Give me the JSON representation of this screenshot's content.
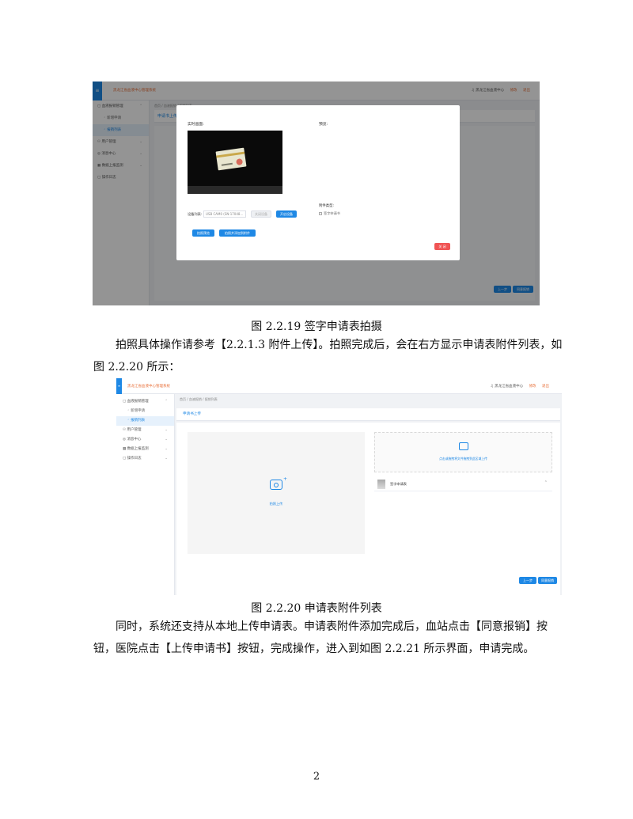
{
  "figure1": {
    "caption": "图 2.2.19  签字申请表拍摄",
    "app_title": "黑龙江省血液中心管理系统",
    "top_right": {
      "center": "黑龙江省血液中心",
      "links": [
        "修改",
        "退出"
      ]
    },
    "sidebar": [
      {
        "label": "血液报销管理",
        "expanded": true
      },
      {
        "label": "新增申请",
        "sub": true,
        "active": false
      },
      {
        "label": "报销列表",
        "sub": true,
        "active": true
      },
      {
        "label": "用户管理",
        "expanded": false
      },
      {
        "label": "消息中心",
        "expanded": false
      },
      {
        "label": "数据上报监测",
        "expanded": false
      },
      {
        "label": "操作日志",
        "expanded": false
      }
    ],
    "breadcrumb": "首页 / 血液报销 / 报销列表",
    "tab": "申请书上传",
    "modal": {
      "realtime_label": "实时画面:",
      "preview_label": "预览:",
      "device_label": "设备列表:",
      "device_value": "USB CAM0 (SN:17048...",
      "btn_disable": "关闭设备",
      "btn_open": "开启设备",
      "btn_photo": "拍照预览",
      "btn_upload": "拍照并添加到附件",
      "attach_type_label": "附件类型:",
      "attach_option": "签字申请书",
      "btn_close": "关 闭"
    },
    "footer_buttons": [
      "上一步",
      "同意报销"
    ]
  },
  "text": {
    "para1_line1": "拍照具体操作请参考【2.2.1.3 附件上传】。拍照完成后，会在右方显示申请表附件列表，如",
    "para1_line2": "图 2.2.20 所示："
  },
  "figure2": {
    "caption": "图 2.2.20  申请表附件列表",
    "app_title": "黑龙江省血液中心管理系统",
    "top_right": {
      "center": "黑龙江省血液中心",
      "links": [
        "修改",
        "退出"
      ]
    },
    "sidebar": [
      {
        "label": "血液报销管理",
        "expanded": true
      },
      {
        "label": "新增申请",
        "sub": true,
        "active": false
      },
      {
        "label": "报销列表",
        "sub": true,
        "active": true
      },
      {
        "label": "用户管理",
        "expanded": false
      },
      {
        "label": "消息中心",
        "expanded": false
      },
      {
        "label": "数据上报监测",
        "expanded": false
      },
      {
        "label": "操作日志",
        "expanded": false
      }
    ],
    "breadcrumb": "首页 / 血液报销 / 报销列表",
    "tab": "申请书上传",
    "photo_caption": "拍照上传",
    "upload_hint": "点击或拖拽将文件拖拽到此区域上传",
    "file_name": "签字申请表",
    "footer_buttons": [
      "上一步",
      "同意报销"
    ]
  },
  "text2": {
    "para2_line1": "同时，系统还支持从本地上传申请表。申请表附件添加完成后，血站点击【同意报销】按",
    "para2_line2": "钮，医院点击【上传申请书】按钮，完成操作，进入到如图 2.2.21 所示界面，申请完成。"
  },
  "page_number": "2"
}
